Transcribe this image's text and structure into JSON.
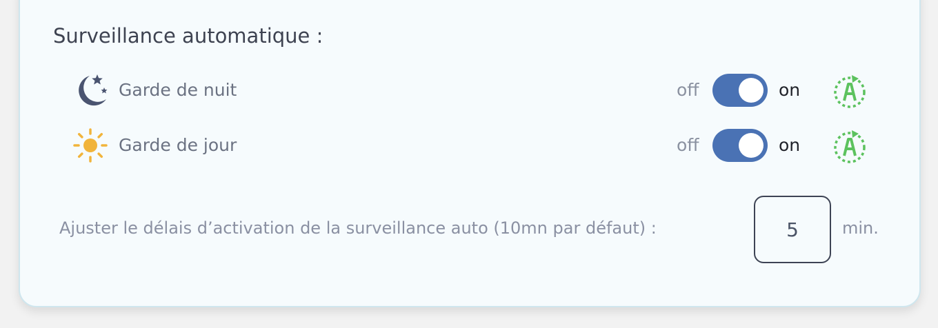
{
  "section": {
    "title": "Surveillance automatique :"
  },
  "rows": [
    {
      "label": "Garde de nuit",
      "icon": "moon-stars-icon",
      "off_label": "off",
      "on_label": "on",
      "state": "on",
      "auto_icon": "auto-mode-icon"
    },
    {
      "label": "Garde de jour",
      "icon": "sun-icon",
      "off_label": "off",
      "on_label": "on",
      "state": "on",
      "auto_icon": "auto-mode-icon"
    }
  ],
  "delay": {
    "label": "Ajuster le délais d’activation de la surveillance auto (10mn par défaut) :",
    "value": "5",
    "unit": "min."
  },
  "colors": {
    "toggle_on": "#4a72b4",
    "auto_icon": "#5cc25e",
    "moon_icon": "#4a5470",
    "sun_icon": "#f1b43b"
  }
}
